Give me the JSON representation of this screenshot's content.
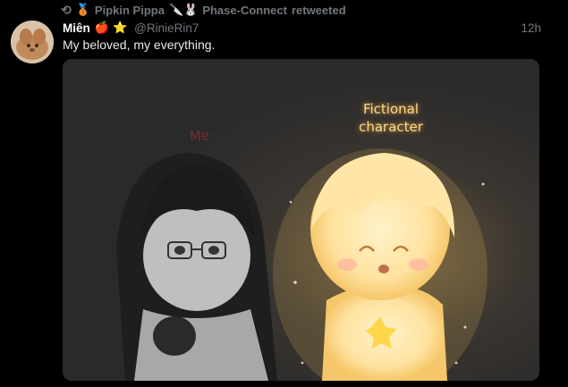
{
  "retweet_bar": {
    "icon": "retweet-icon",
    "user1_badge": "🥉",
    "user1": "Pipkin Pippa",
    "user2_icons": "🔪🐰",
    "user2": "Phase-Connect",
    "suffix": "retweeted"
  },
  "tweet": {
    "author_name": "Miên",
    "badges": [
      "🍎",
      "⭐"
    ],
    "handle": "@RinieRin7",
    "time": "12h",
    "text": "My beloved, my everything."
  },
  "media": {
    "label_me": "Me",
    "label_fictional": "Fictional character"
  }
}
